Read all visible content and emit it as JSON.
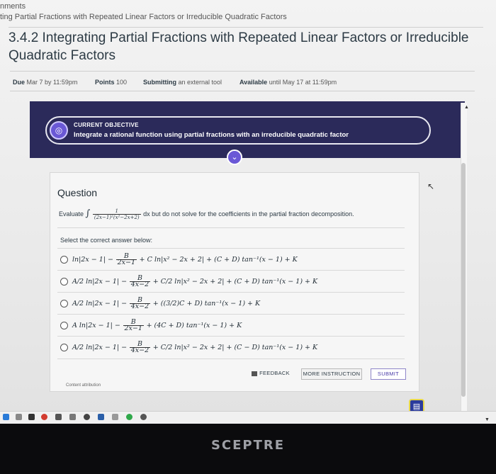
{
  "breadcrumb": {
    "line1": "nments",
    "line2": "ting Partial Fractions with Repeated Linear Factors or Irreducible Quadratic Factors"
  },
  "assignment": {
    "title": "3.4.2 Integrating Partial Fractions with Repeated Linear Factors or Irreducible Quadratic Factors",
    "due_label": "Due",
    "due_value": "Mar 7 by 11:59pm",
    "points_label": "Points",
    "points_value": "100",
    "submitting_label": "Submitting",
    "submitting_value": "an external tool",
    "available_label": "Available",
    "available_value": "until May 17 at 11:59pm"
  },
  "objective": {
    "heading": "CURRENT OBJECTIVE",
    "text": "Integrate a rational function using partial fractions with an irreducible quadratic factor"
  },
  "question": {
    "heading": "Question",
    "evaluate_prefix": "Evaluate",
    "integrand_num": "1",
    "integrand_den": "(2x−1)²(x²−2x+2)",
    "evaluate_suffix": "dx but do not solve for the coefficients in the partial fraction decomposition.",
    "select_prompt": "Select the correct answer below:",
    "options": [
      {
        "a": "ln|2x − 1| −",
        "fnum": "B",
        "fden": "2x−1",
        "b": "+ C ln|x² − 2x + 2| + (C + D) tan⁻¹(x − 1) + K"
      },
      {
        "a": "A/2 ln|2x − 1| −",
        "fnum": "B",
        "fden": "4x−2",
        "b": "+ C/2 ln|x² − 2x + 2| + (C + D) tan⁻¹(x − 1) + K"
      },
      {
        "a": "A/2 ln|2x − 1| −",
        "fnum": "B",
        "fden": "4x−2",
        "b": "+ ((3/2)C + D) tan⁻¹(x − 1) + K"
      },
      {
        "a": "A ln|2x − 1| −",
        "fnum": "B",
        "fden": "2x−1",
        "b": "+ (4C + D) tan⁻¹(x − 1) + K"
      },
      {
        "a": "A/2 ln|2x − 1| −",
        "fnum": "B",
        "fden": "4x−2",
        "b": "+ C/2 ln|x² − 2x + 2| + (C − D) tan⁻¹(x − 1) + K"
      }
    ]
  },
  "buttons": {
    "feedback": "FEEDBACK",
    "more": "MORE INSTRUCTION",
    "submit": "SUBMIT"
  },
  "attribution": "Content attribution",
  "monitor_brand": "SCEPTRE",
  "colors": {
    "banner": "#2b2a5a",
    "accent": "#6a58d6"
  }
}
